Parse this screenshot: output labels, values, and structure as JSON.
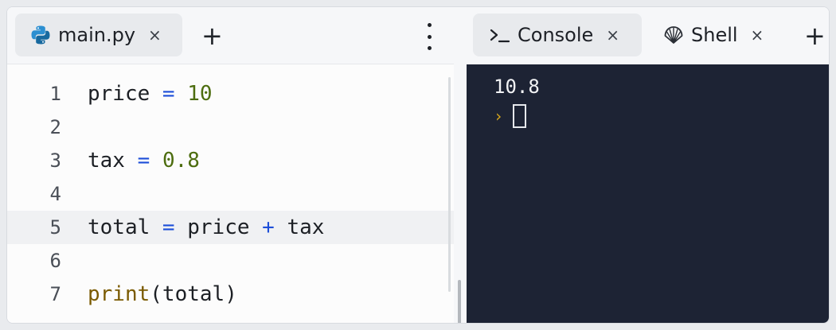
{
  "editor": {
    "tab": {
      "label": "main.py",
      "close": "×",
      "icon": "python-icon"
    },
    "new_tab": "+",
    "menu_icon": "kebab-menu-icon",
    "lines": [
      {
        "num": "1",
        "tokens": [
          {
            "t": "price",
            "k": "id"
          },
          {
            "t": " = ",
            "k": "op"
          },
          {
            "t": "10",
            "k": "num"
          }
        ]
      },
      {
        "num": "2",
        "tokens": []
      },
      {
        "num": "3",
        "tokens": [
          {
            "t": "tax",
            "k": "id"
          },
          {
            "t": " = ",
            "k": "op"
          },
          {
            "t": "0.8",
            "k": "num"
          }
        ]
      },
      {
        "num": "4",
        "tokens": []
      },
      {
        "num": "5",
        "tokens": [
          {
            "t": "total",
            "k": "id"
          },
          {
            "t": " = ",
            "k": "op"
          },
          {
            "t": "price",
            "k": "id"
          },
          {
            "t": " + ",
            "k": "op"
          },
          {
            "t": "tax",
            "k": "id"
          }
        ],
        "active": true
      },
      {
        "num": "6",
        "tokens": []
      },
      {
        "num": "7",
        "tokens": [
          {
            "t": "print",
            "k": "fn"
          },
          {
            "t": "(total)",
            "k": "id"
          }
        ]
      }
    ]
  },
  "console": {
    "tabs": [
      {
        "label": "Console",
        "close": "×",
        "icon": "terminal-icon",
        "active": true
      },
      {
        "label": "Shell",
        "close": "×",
        "icon": "shell-icon",
        "active": false
      }
    ],
    "new_tab": "+",
    "output": "10.8",
    "prompt": "›"
  },
  "colors": {
    "console_bg": "#1d2334",
    "keyword_op": "#1d4ed8",
    "number": "#4d6d0f",
    "function": "#7a5a00",
    "prompt": "#d6a51b"
  }
}
